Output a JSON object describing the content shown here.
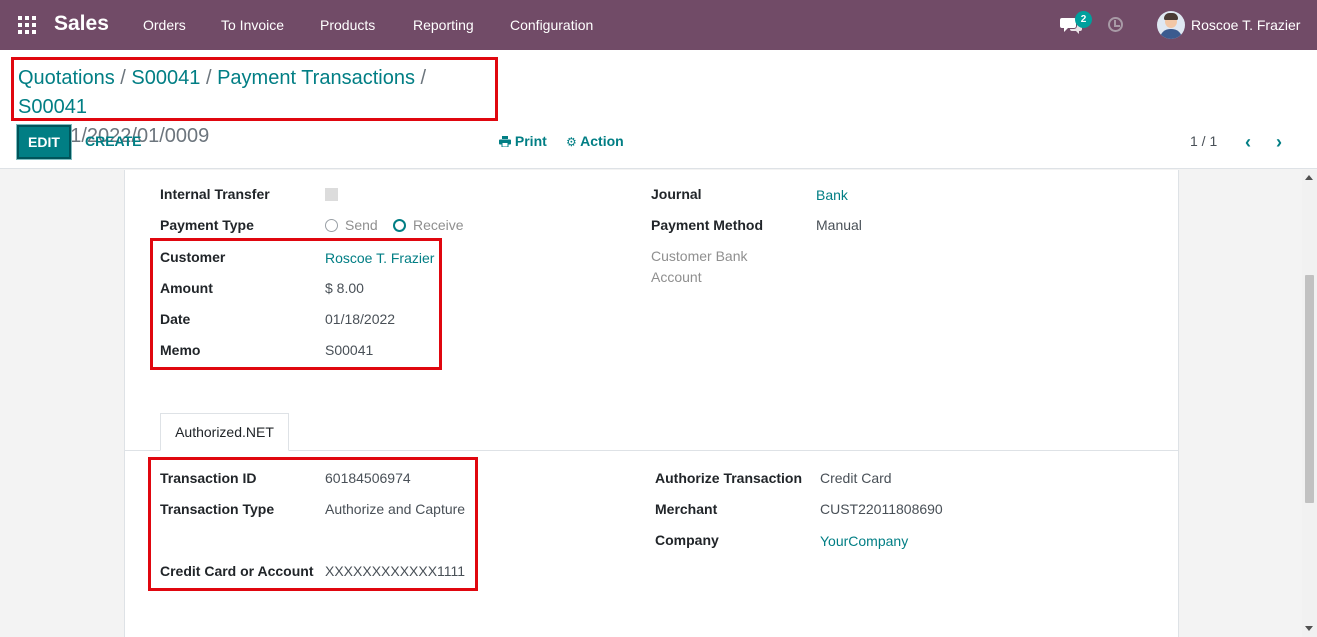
{
  "navbar": {
    "app_name": "Sales",
    "menu": [
      "Orders",
      "To Invoice",
      "Products",
      "Reporting",
      "Configuration"
    ],
    "chat_badge": "2",
    "user_name": "Roscoe T. Frazier",
    "icons": {
      "apps": "apps-grid-icon",
      "chat": "chat-bubbles-icon",
      "activity": "clock-icon"
    }
  },
  "breadcrumb": {
    "items": [
      "Quotations",
      "S00041",
      "Payment Transactions",
      "S00041"
    ],
    "current": "BNK1/2022/01/0009"
  },
  "buttons": {
    "edit": "EDIT",
    "create": "CREATE",
    "print": "Print",
    "action": "Action"
  },
  "pager": {
    "value": "1 / 1"
  },
  "form": {
    "left": {
      "internal_transfer_label": "Internal Transfer",
      "internal_transfer_checked": false,
      "payment_type_label": "Payment Type",
      "payment_type_options": [
        "Send",
        "Receive"
      ],
      "payment_type_selected": "Receive",
      "customer_label": "Customer",
      "customer_value": "Roscoe T. Frazier",
      "amount_label": "Amount",
      "amount_value": "$ 8.00",
      "date_label": "Date",
      "date_value": "01/18/2022",
      "memo_label": "Memo",
      "memo_value": "S00041"
    },
    "right": {
      "journal_label": "Journal",
      "journal_value": "Bank",
      "payment_method_label": "Payment Method",
      "payment_method_value": "Manual",
      "customer_bank_label_1": "Customer Bank",
      "customer_bank_label_2": "Account"
    }
  },
  "tab": {
    "label": "Authorized.NET"
  },
  "authorize": {
    "transaction_id_label": "Transaction ID",
    "transaction_id_value": "60184506974",
    "transaction_type_label": "Transaction Type",
    "transaction_type_value": "Authorize and Capture",
    "credit_card_label": "Credit Card or Account",
    "credit_card_value": "XXXXXXXXXXXX1111",
    "authorize_transaction_label": "Authorize Transaction",
    "authorize_transaction_value": "Credit Card",
    "merchant_label": "Merchant",
    "merchant_value": "CUST22011808690",
    "company_label": "Company",
    "company_value": "YourCompany"
  },
  "colors": {
    "navbar": "#714b67",
    "accent": "#017e84",
    "highlight_box": "#e0070f"
  }
}
